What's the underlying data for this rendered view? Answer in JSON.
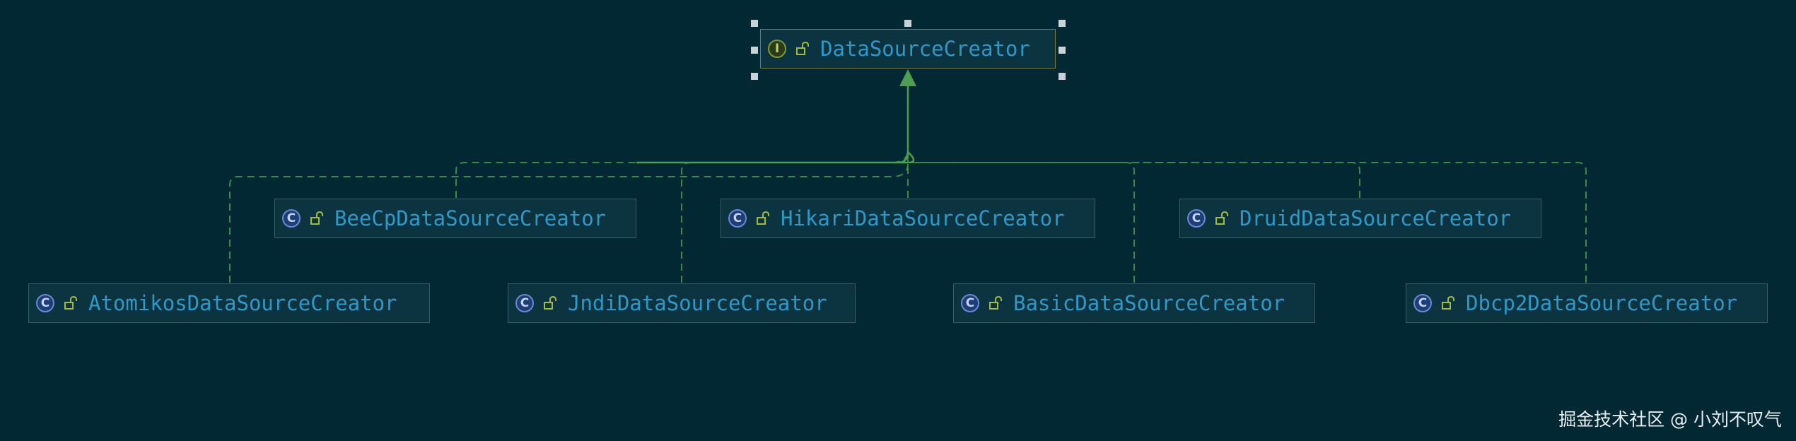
{
  "diagram": {
    "root": {
      "name": "DataSourceCreator",
      "kind": "interface",
      "kind_glyph": "I",
      "visibility": "public"
    },
    "implementations": [
      {
        "id": "beecp",
        "name": "BeeCpDataSourceCreator",
        "kind": "class",
        "kind_glyph": "C",
        "visibility": "public"
      },
      {
        "id": "hikari",
        "name": "HikariDataSourceCreator",
        "kind": "class",
        "kind_glyph": "C",
        "visibility": "public"
      },
      {
        "id": "druid",
        "name": "DruidDataSourceCreator",
        "kind": "class",
        "kind_glyph": "C",
        "visibility": "public"
      },
      {
        "id": "atomikos",
        "name": "AtomikosDataSourceCreator",
        "kind": "class",
        "kind_glyph": "C",
        "visibility": "public"
      },
      {
        "id": "jndi",
        "name": "JndiDataSourceCreator",
        "kind": "class",
        "kind_glyph": "C",
        "visibility": "public"
      },
      {
        "id": "basic",
        "name": "BasicDataSourceCreator",
        "kind": "class",
        "kind_glyph": "C",
        "visibility": "public"
      },
      {
        "id": "dbcp2",
        "name": "Dbcp2DataSourceCreator",
        "kind": "class",
        "kind_glyph": "C",
        "visibility": "public"
      }
    ],
    "relation": "implements",
    "selected": "DataSourceCreator",
    "colors": {
      "background": "#022834",
      "node_fill": "#0c3340",
      "node_text": "#2f98c7",
      "edge_active": "#4e9e50",
      "edge_dashed": "#3b8a45"
    }
  },
  "watermark": "掘金技术社区 @ 小刘不叹气"
}
